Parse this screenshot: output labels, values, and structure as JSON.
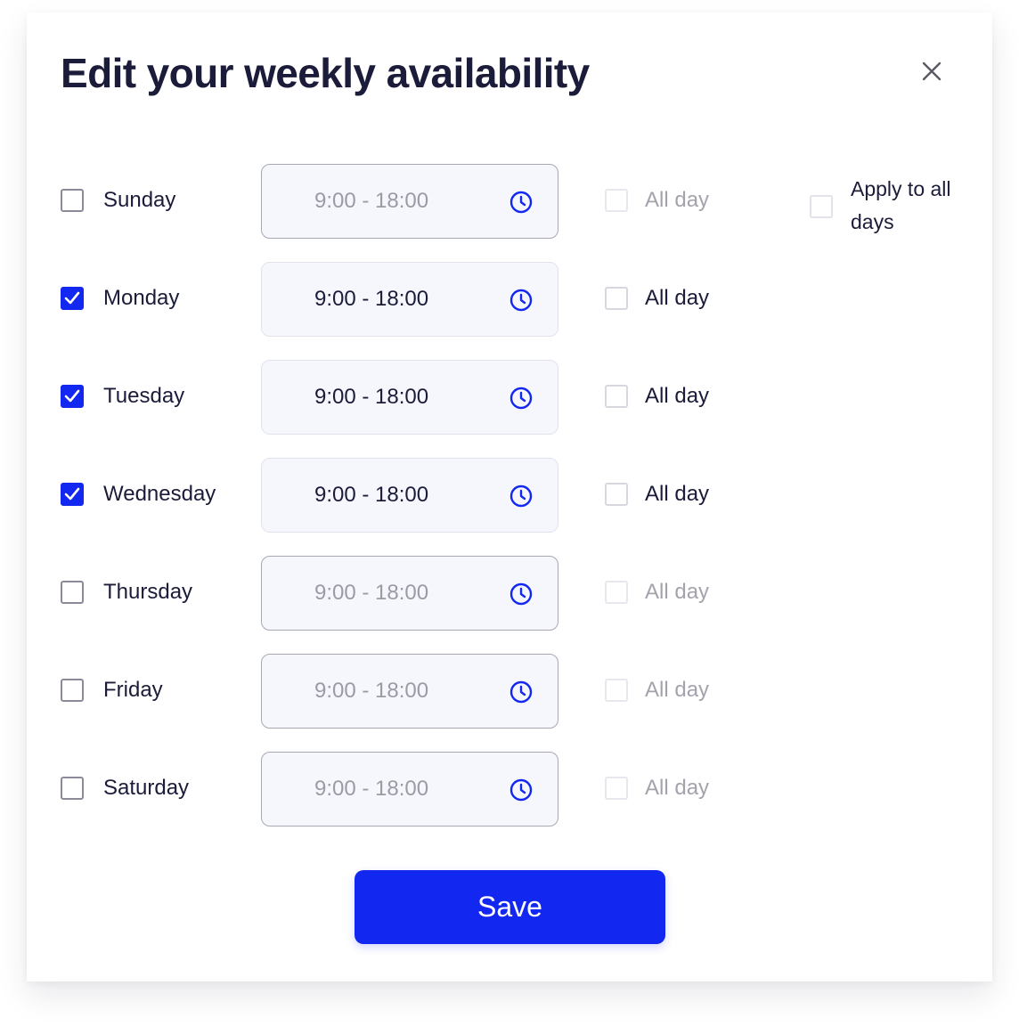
{
  "modal": {
    "title": "Edit your weekly availability",
    "close_icon": "close-icon",
    "apply_to_all": {
      "label": "Apply to all days",
      "checked": false
    },
    "save_label": "Save"
  },
  "days": [
    {
      "name": "Sunday",
      "enabled": false,
      "time": "9:00 - 18:00",
      "all_day_label": "All day",
      "all_day": false
    },
    {
      "name": "Monday",
      "enabled": true,
      "time": "9:00 - 18:00",
      "all_day_label": "All day",
      "all_day": false
    },
    {
      "name": "Tuesday",
      "enabled": true,
      "time": "9:00 - 18:00",
      "all_day_label": "All day",
      "all_day": false
    },
    {
      "name": "Wednesday",
      "enabled": true,
      "time": "9:00 - 18:00",
      "all_day_label": "All day",
      "all_day": false
    },
    {
      "name": "Thursday",
      "enabled": false,
      "time": "9:00 - 18:00",
      "all_day_label": "All day",
      "all_day": false
    },
    {
      "name": "Friday",
      "enabled": false,
      "time": "9:00 - 18:00",
      "all_day_label": "All day",
      "all_day": false
    },
    {
      "name": "Saturday",
      "enabled": false,
      "time": "9:00 - 18:00",
      "all_day_label": "All day",
      "all_day": false
    }
  ],
  "icons": {
    "time": "clock-icon",
    "checked": "checkmark-icon"
  },
  "colors": {
    "accent": "#1228f0",
    "text": "#1b1b3a",
    "muted": "#9b9ba6",
    "field_bg": "#f6f7fd"
  }
}
